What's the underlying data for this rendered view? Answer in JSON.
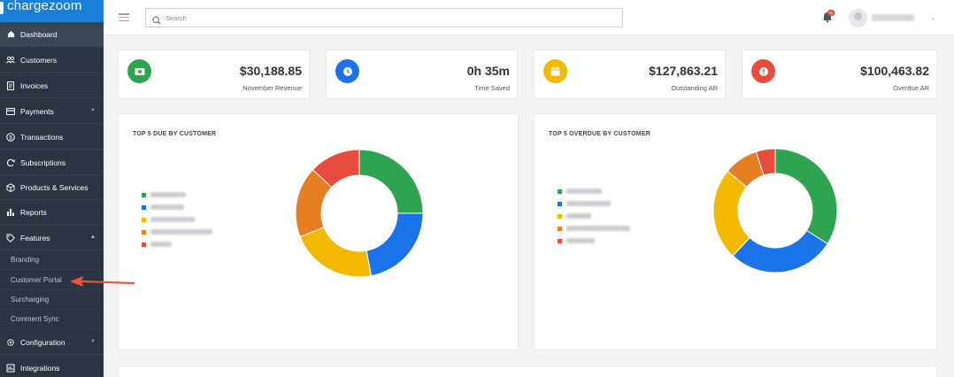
{
  "brand": {
    "name": "chargezoom"
  },
  "sidebar": {
    "items": [
      {
        "label": "Dashboard",
        "icon": "home-icon"
      },
      {
        "label": "Customers",
        "icon": "users-icon"
      },
      {
        "label": "Invoices",
        "icon": "invoice-icon"
      },
      {
        "label": "Payments",
        "icon": "payment-card-icon"
      },
      {
        "label": "Transactions",
        "icon": "dollar-icon"
      },
      {
        "label": "Subscriptions",
        "icon": "refresh-icon"
      },
      {
        "label": "Products & Services",
        "icon": "box-icon"
      },
      {
        "label": "Reports",
        "icon": "bar-chart-icon"
      },
      {
        "label": "Features",
        "icon": "tag-icon"
      },
      {
        "label": "Configuration",
        "icon": "gear-icon"
      },
      {
        "label": "Integrations",
        "icon": "integration-icon"
      }
    ],
    "features_sub": [
      {
        "label": "Branding"
      },
      {
        "label": "Customer Portal"
      },
      {
        "label": "Surcharging"
      },
      {
        "label": "Comment Sync"
      }
    ]
  },
  "header": {
    "search_placeholder": "Search",
    "notification_count": "99"
  },
  "stats": [
    {
      "value": "$30,188.85",
      "label": "November Revenue",
      "color": "#2ea44f",
      "icon": "cash-icon"
    },
    {
      "value": "0h 35m",
      "label": "Time Saved",
      "color": "#1a73e8",
      "icon": "clock-icon"
    },
    {
      "value": "$127,863.21",
      "label": "Outstanding AR",
      "color": "#f5b800",
      "icon": "calendar-icon"
    },
    {
      "value": "$100,463.82",
      "label": "Overdue AR",
      "color": "#e74c3c",
      "icon": "alert-icon"
    }
  ],
  "panels": [
    {
      "title": "TOP 5 DUE BY CUSTOMER"
    },
    {
      "title": "TOP 5 OVERDUE BY CUSTOMER"
    }
  ],
  "chart_data": [
    {
      "type": "pie",
      "title": "TOP 5 DUE BY CUSTOMER",
      "donut": true,
      "values": [
        25,
        22,
        22,
        18,
        13
      ],
      "colors": [
        "#2ea44f",
        "#1a73e8",
        "#f5b800",
        "#e67e22",
        "#e74c3c"
      ]
    },
    {
      "type": "pie",
      "title": "TOP 5 OVERDUE BY CUSTOMER",
      "donut": true,
      "values": [
        34,
        28,
        24,
        9,
        5
      ],
      "colors": [
        "#2ea44f",
        "#1a73e8",
        "#f5b800",
        "#e67e22",
        "#e74c3c"
      ]
    }
  ]
}
